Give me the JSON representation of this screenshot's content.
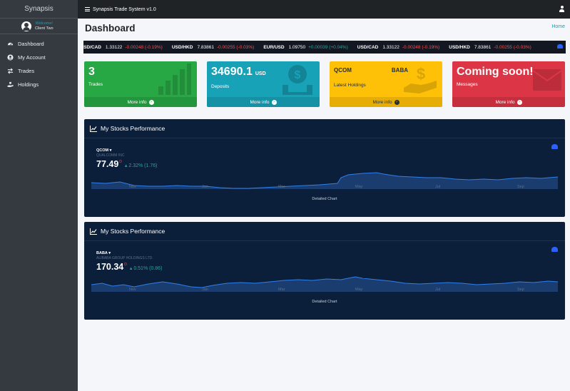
{
  "sidebar": {
    "brand": "Synapsis",
    "welcome": "Welcome!",
    "user_name": "Client Two",
    "items": [
      {
        "label": "Dashboard",
        "icon": "gauge-icon"
      },
      {
        "label": "My Account",
        "icon": "user-circle-icon"
      },
      {
        "label": "Trades",
        "icon": "exchange-icon"
      },
      {
        "label": "Holdings",
        "icon": "hand-holding-icon"
      }
    ]
  },
  "topbar": {
    "title": "Synapsis Trade System v1.0"
  },
  "page": {
    "title": "Dashboard",
    "breadcrumb_home": "Home"
  },
  "ticker": [
    {
      "symbol": "SD/CAD",
      "price": "1.33122",
      "change": "-0.00248 (-0.19%)",
      "direction": "down"
    },
    {
      "symbol": "USD/HKD",
      "price": "7.83861",
      "change": "-0.00255 (-0.03%)",
      "direction": "down"
    },
    {
      "symbol": "EUR/USD",
      "price": "1.09750",
      "change": "+0.00039 (+0.04%)",
      "direction": "up"
    },
    {
      "symbol": "USD/CAD",
      "price": "1.33122",
      "change": "-0.00248 (-0.19%)",
      "direction": "down"
    },
    {
      "symbol": "USD/HKD",
      "price": "7.83861",
      "change": "-0.00255 (-0.03%)",
      "direction": "down"
    }
  ],
  "boxes": {
    "trades": {
      "value": "3",
      "label": "Trades",
      "footer": "More info",
      "color": "#28a745"
    },
    "deposits": {
      "value": "34690.1",
      "unit": "USD",
      "label": "Deposits",
      "footer": "More info",
      "color": "#17a2b8"
    },
    "holdings": {
      "sym1": "QCOM",
      "sym2": "BABA",
      "label": "Latest Holdings",
      "footer": "More info",
      "color": "#ffc107"
    },
    "messages": {
      "value": "Coming soon!",
      "label": "Messages",
      "footer": "More info",
      "color": "#dc3545"
    }
  },
  "charts": [
    {
      "header": "My Stocks Performance",
      "symbol": "QCOM",
      "company": "QUALCOMM INC",
      "price": "77.49",
      "currency": "D",
      "change": "2.32% (1.76)",
      "months": [
        "Nov",
        "Jan",
        "Mar",
        "May",
        "Jul",
        "Sep"
      ],
      "detail": "Detailed Chart"
    },
    {
      "header": "My Stocks Performance",
      "symbol": "BABA",
      "company": "ALIBABA GROUP HOLDINGS LTD.",
      "price": "170.34",
      "currency": "D",
      "change": "0.51% (0.86)",
      "months": [
        "Nov",
        "Jan",
        "Mar",
        "May",
        "Jul",
        "Sep"
      ],
      "detail": "Detailed Chart"
    }
  ]
}
